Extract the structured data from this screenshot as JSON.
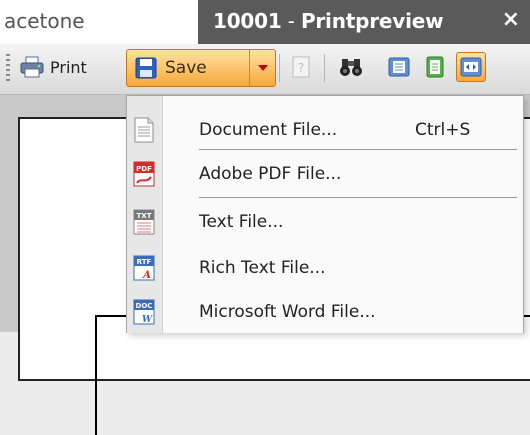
{
  "window": {
    "left_title": "acetone",
    "doc_tab": {
      "number": "10001",
      "separator": " - ",
      "name": "Printpreview",
      "close_glyph": "×"
    }
  },
  "toolbar": {
    "print_label": "Print",
    "save_label": "Save",
    "icons": [
      "printer-icon",
      "floppy-disk-icon",
      "help-icon",
      "binoculars-icon",
      "page-view-icon",
      "single-page-icon",
      "page-width-icon"
    ]
  },
  "save_menu": {
    "items": [
      {
        "label": "Document File...",
        "shortcut": "Ctrl+S",
        "icon": "document-file-icon"
      },
      {
        "label": "Adobe PDF File...",
        "shortcut": "",
        "icon": "pdf-file-icon"
      },
      {
        "label": "Text File...",
        "shortcut": "",
        "icon": "txt-file-icon"
      },
      {
        "label": "Rich Text File...",
        "shortcut": "",
        "icon": "rtf-file-icon"
      },
      {
        "label": "Microsoft Word File...",
        "shortcut": "",
        "icon": "doc-file-icon"
      }
    ]
  },
  "icon_text": {
    "pdf": "PDF",
    "txt": "TXT",
    "rtf": "RTF",
    "doc": "DOC",
    "rtf_mark": "A",
    "doc_mark": "W"
  },
  "colors": {
    "accent_orange": "#f8a83a",
    "save_blue": "#2d5fc4",
    "tab_bg": "#5a5a5a"
  }
}
